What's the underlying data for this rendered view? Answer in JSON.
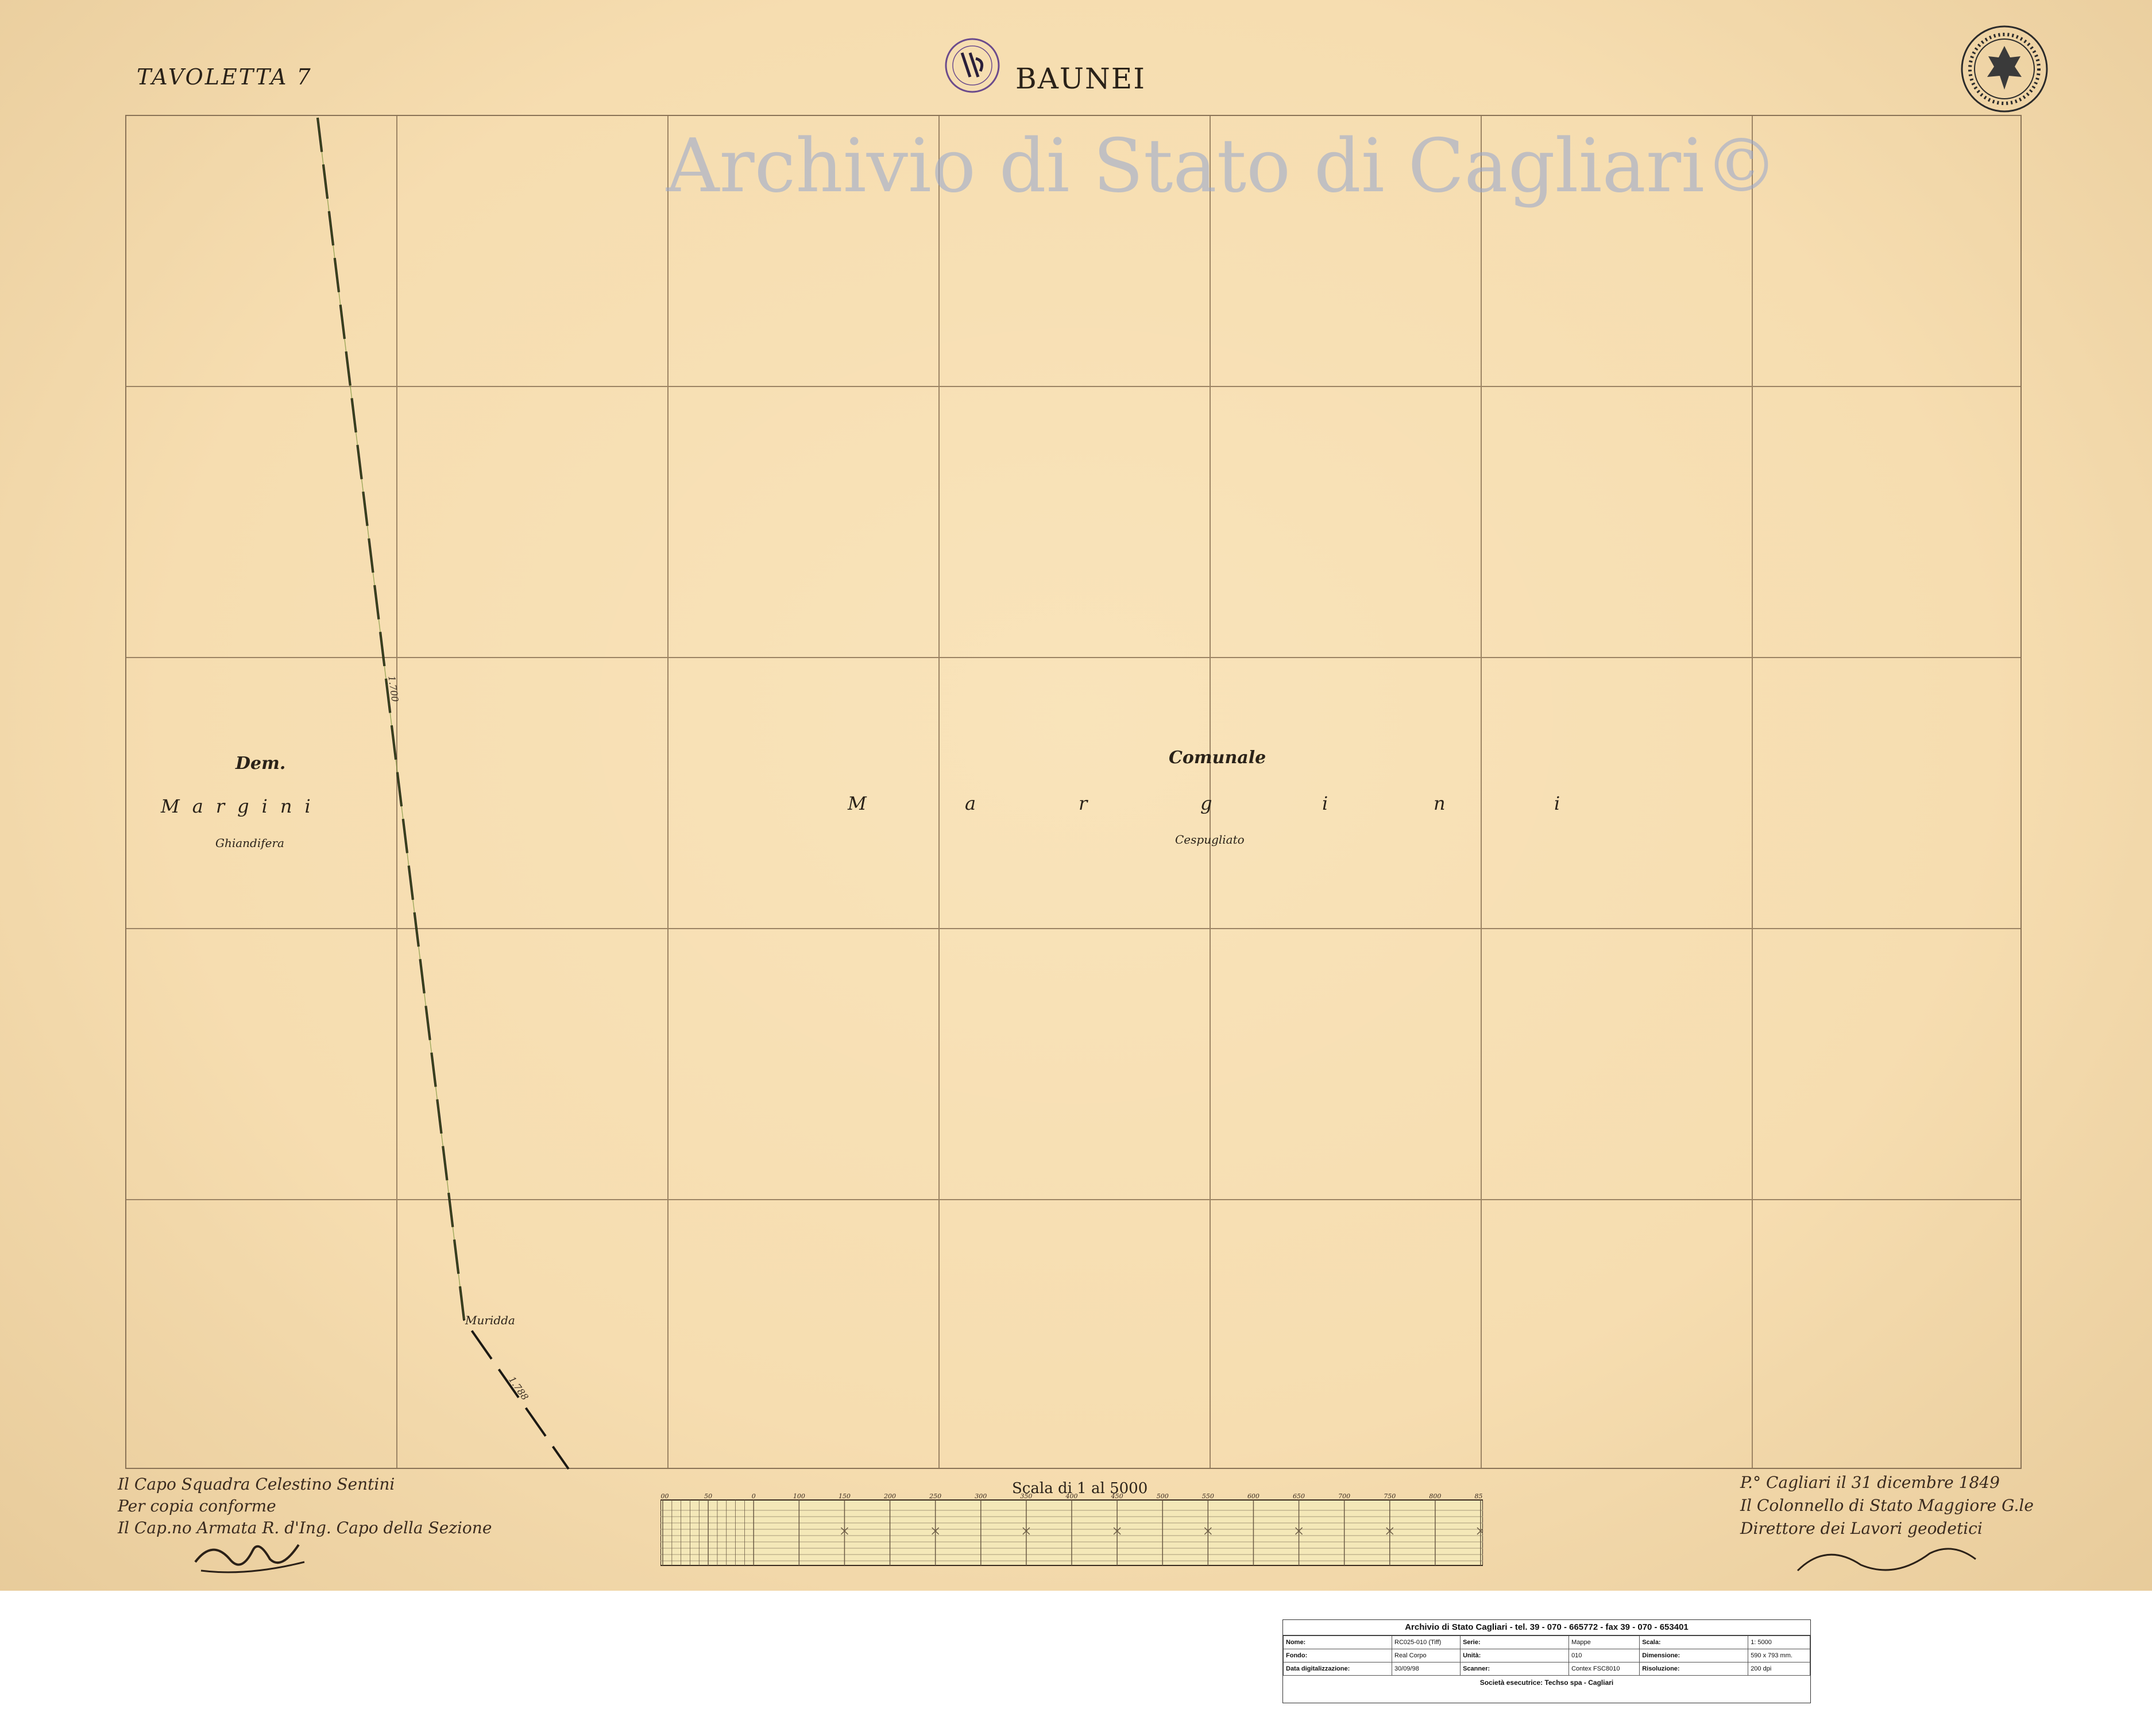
{
  "sheet": {
    "label": "TAVOLETTA 7",
    "title": "BAUNEI",
    "watermark": "Archivio di Stato di Cagliari©"
  },
  "regions": {
    "left": {
      "abbr": "Dem.",
      "name": "Margini",
      "subtitle": "Ghiandifera"
    },
    "right": {
      "abbr": "Comunale",
      "letters": [
        "M",
        "a",
        "r",
        "g",
        "i",
        "n",
        "i"
      ],
      "subtitle": "Cespugliato"
    }
  },
  "boundary": {
    "point_name": "Muridda",
    "segment_labels": [
      "1.700",
      "1.788"
    ]
  },
  "certification": {
    "lines": [
      "Il Capo Squadra Celestino Sentini",
      "Per copia conforme",
      "Il Cap.no Armata R. d'Ing. Capo della Sezione"
    ]
  },
  "date_block": {
    "lines": [
      "P.° Cagliari il 31 dicembre 1849",
      "Il Colonnello di Stato Maggiore G.le",
      "Direttore dei Lavori geodetici"
    ],
    "signature": "C. De Candia"
  },
  "scale": {
    "title": "Scala di 1 al 5000",
    "ticks": [
      "100",
      "50",
      "0",
      "100",
      "150",
      "200",
      "250",
      "300",
      "350",
      "400",
      "450",
      "500",
      "550",
      "600",
      "650",
      "700",
      "750",
      "800",
      "850"
    ]
  },
  "stamps": {
    "top": "R. Archivio di Stato Cagliari",
    "seal": "Archivio di Stato Cagliari"
  },
  "info_panel": {
    "header": "Archivio di Stato Cagliari - tel. 39 - 070 - 665772 - fax 39 - 070 - 653401",
    "rows": [
      [
        {
          "k": "Nome:",
          "v": "RC025-010 (Tiff)"
        },
        {
          "k": "Serie:",
          "v": "Mappe"
        },
        {
          "k": "Scala:",
          "v": "1: 5000"
        }
      ],
      [
        {
          "k": "Fondo:",
          "v": "Real Corpo"
        },
        {
          "k": "Unità:",
          "v": "010"
        },
        {
          "k": "Dimensione:",
          "v": "590 x 793 mm."
        }
      ],
      [
        {
          "k": "Data digitalizzazione:",
          "v": "30/09/98"
        },
        {
          "k": "Scanner:",
          "v": "Contex FSC8010"
        },
        {
          "k": "Risoluzione:",
          "v": "200 dpi"
        }
      ]
    ],
    "footer": "Società esecutrice: Techso spa - Cagliari"
  }
}
